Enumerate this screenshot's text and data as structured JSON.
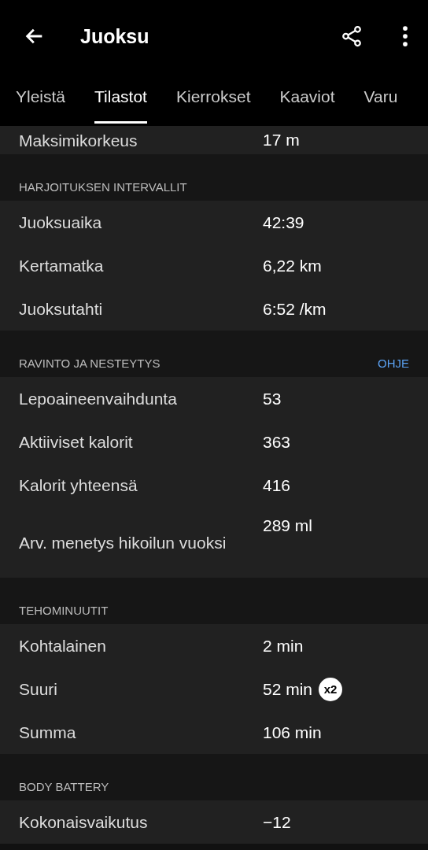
{
  "header": {
    "title": "Juoksu"
  },
  "tabs": [
    {
      "label": "Yleistä",
      "selected": false
    },
    {
      "label": "Tilastot",
      "selected": true
    },
    {
      "label": "Kierrokset",
      "selected": false
    },
    {
      "label": "Kaaviot",
      "selected": false
    },
    {
      "label": "Varu",
      "selected": false
    }
  ],
  "partial_row": {
    "label": "Maksimikorkeus",
    "value": "17 m"
  },
  "sections": [
    {
      "title": "HARJOITUKSEN INTERVALLIT",
      "rows": [
        {
          "label": "Juoksuaika",
          "value": "42:39"
        },
        {
          "label": "Kertamatka",
          "value": "6,22 km"
        },
        {
          "label": "Juoksutahti",
          "value": "6:52 /km"
        }
      ]
    },
    {
      "title": "RAVINTO JA NESTEYTYS",
      "link": "OHJE",
      "rows": [
        {
          "label": "Lepoaineenvaihdunta",
          "value": "53"
        },
        {
          "label": "Aktiiviset kalorit",
          "value": "363"
        },
        {
          "label": "Kalorit yhteensä",
          "value": "416"
        },
        {
          "label": "Arv. menetys hikoilun vuoksi",
          "value": "289 ml"
        }
      ]
    },
    {
      "title": "TEHOMINUUTIT",
      "rows": [
        {
          "label": "Kohtalainen",
          "value": "2 min"
        },
        {
          "label": "Suuri",
          "value": "52 min",
          "badge": "x2"
        },
        {
          "label": "Summa",
          "value": "106 min"
        }
      ]
    },
    {
      "title": "BODY BATTERY",
      "rows": [
        {
          "label": "Kokonaisvaikutus",
          "value": "−12"
        }
      ]
    }
  ]
}
